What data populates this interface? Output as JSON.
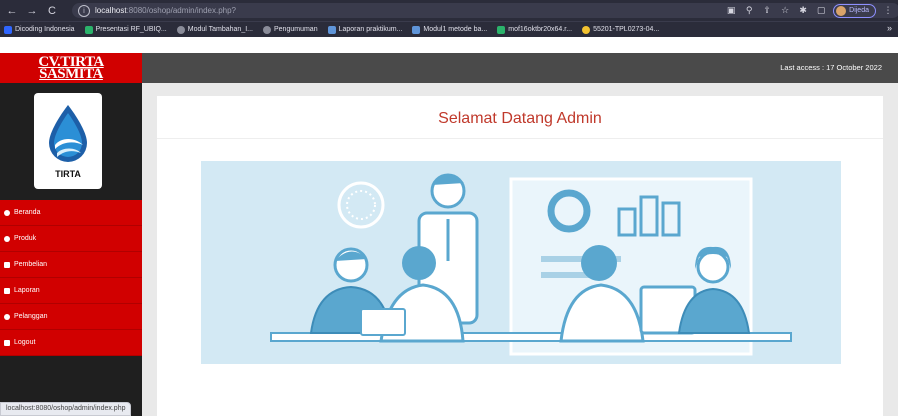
{
  "browser": {
    "url_host": "localhost",
    "url_path": ":8080/oshop/admin/index.php?",
    "profile_label": "Dijeda",
    "bookmarks": [
      "Dicoding Indonesia",
      "Presentasi RF_UBIQ...",
      "Modul Tambahan_I...",
      "Pengumuman",
      "Laporan praktikum...",
      "Modul1 metode ba...",
      "mof16oktbr20x64.r...",
      "55201-TPL0273-04..."
    ],
    "status_url": "localhost:8080/oshop/admin/index.php"
  },
  "brand": {
    "line1": "CV.TIRTA",
    "line2": "SASMITA",
    "logo_word": "TIRTA"
  },
  "topbar": {
    "last_access": "Last access : 17 October 2022"
  },
  "menu": [
    {
      "label": "Beranda"
    },
    {
      "label": "Produk"
    },
    {
      "label": "Pembelian"
    },
    {
      "label": "Laporan"
    },
    {
      "label": "Pelanggan"
    },
    {
      "label": "Logout"
    }
  ],
  "main": {
    "welcome": "Selamat Datang Admin"
  },
  "colors": {
    "brand_red": "#d10000",
    "welcome_text": "#c0392b",
    "illustration_blue": "#5aa7cf"
  }
}
